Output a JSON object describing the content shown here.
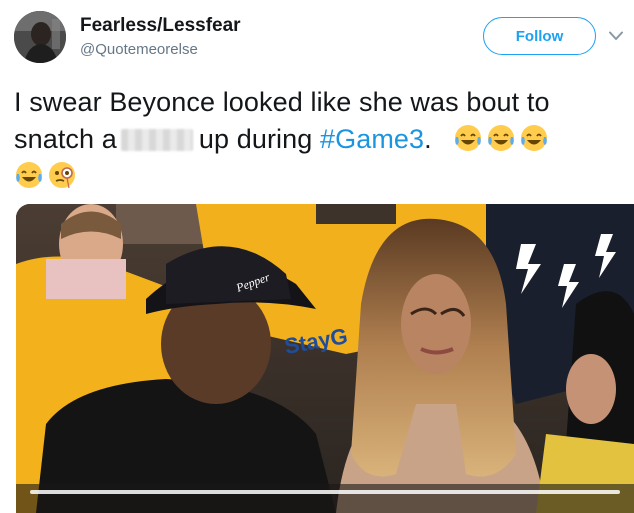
{
  "author": {
    "name": "Fearless/Lessfear",
    "handle": "@Quotemeorelse"
  },
  "actions": {
    "follow_label": "Follow"
  },
  "tweet": {
    "text_part1": "I swear Beyonce looked like she was bout to snatch a",
    "text_part2": "up during",
    "hashtag": "#Game3",
    "text_part3": ".",
    "emojis_line1": [
      "face-with-tears-of-joy",
      "face-with-tears-of-joy",
      "face-with-tears-of-joy"
    ],
    "emojis_line2": [
      "face-with-tears-of-joy",
      "face-with-monocle"
    ]
  },
  "media": {
    "cap_text": "Pepper",
    "shirt_text": "StayG"
  },
  "colors": {
    "accent": "#1da1f2",
    "hashtag": "#1b95e0",
    "handle": "#657786"
  }
}
